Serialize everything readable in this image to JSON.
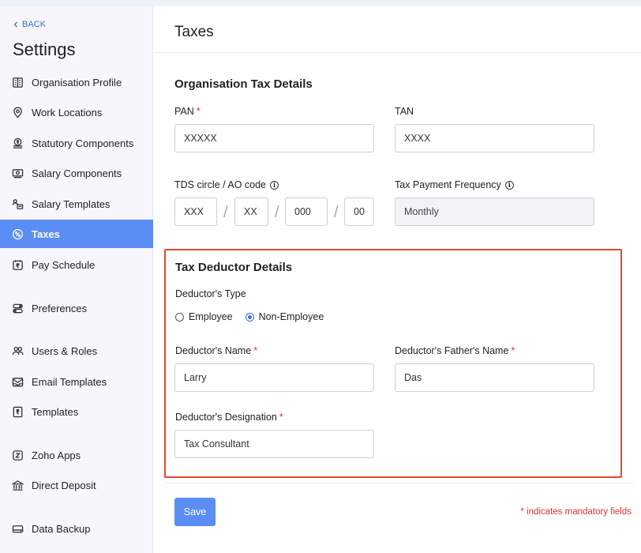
{
  "sidebar": {
    "back_label": "BACK",
    "title": "Settings",
    "items": [
      {
        "label": "Organisation Profile",
        "icon": "building-icon"
      },
      {
        "label": "Work Locations",
        "icon": "location-pin-icon"
      },
      {
        "label": "Statutory Components",
        "icon": "rupee-stack-icon"
      },
      {
        "label": "Salary Components",
        "icon": "money-note-icon"
      },
      {
        "label": "Salary Templates",
        "icon": "template-person-icon"
      },
      {
        "label": "Taxes",
        "icon": "percent-icon",
        "active": true
      },
      {
        "label": "Pay Schedule",
        "icon": "rupee-calendar-icon"
      },
      {
        "label": "Preferences",
        "icon": "toggle-icon"
      },
      {
        "label": "Users & Roles",
        "icon": "users-icon"
      },
      {
        "label": "Email Templates",
        "icon": "email-icon"
      },
      {
        "label": "Templates",
        "icon": "rupee-document-icon"
      },
      {
        "label": "Zoho Apps",
        "icon": "zoho-icon"
      },
      {
        "label": "Direct Deposit",
        "icon": "bank-icon"
      },
      {
        "label": "Data Backup",
        "icon": "backup-drive-icon"
      }
    ]
  },
  "main": {
    "title": "Taxes",
    "org_tax": {
      "section_title": "Organisation Tax Details",
      "pan_label": "PAN",
      "pan_req": "*",
      "pan_value": "XXXXX",
      "tan_label": "TAN",
      "tan_value": "XXXX",
      "tds_label": "TDS circle / AO code",
      "tds_parts": [
        "XXX",
        "XX",
        "000",
        "00"
      ],
      "slash": "/",
      "freq_label": "Tax Payment Frequency",
      "freq_value": "Monthly"
    },
    "deductor": {
      "section_title": "Tax Deductor Details",
      "type_label": "Deductor's Type",
      "options": [
        "Employee",
        "Non-Employee"
      ],
      "selected_option": "Non-Employee",
      "name_label": "Deductor's Name",
      "name_value": "Larry",
      "father_label": "Deductor's Father's Name",
      "father_value": "Das",
      "designation_label": "Deductor's Designation",
      "designation_value": "Tax Consultant",
      "req": "*"
    },
    "save_label": "Save",
    "mandatory_note": "* indicates mandatory fields",
    "info_glyph": "i"
  },
  "colors": {
    "accent": "#5b8ef4",
    "required": "#e0302d",
    "highlight_box": "#e04a2b"
  }
}
